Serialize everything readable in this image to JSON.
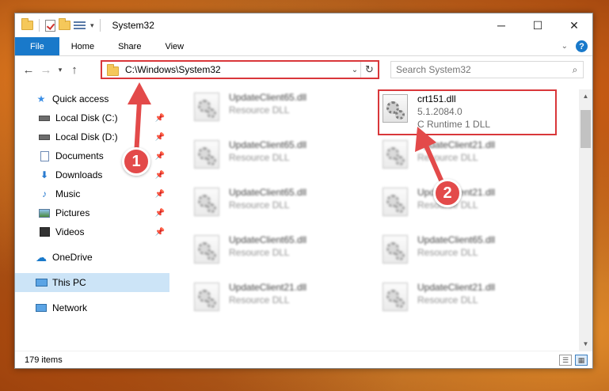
{
  "window": {
    "title": "System32",
    "controls": {
      "minimize": "─",
      "maximize": "☐",
      "close": "✕"
    }
  },
  "ribbon": {
    "tabs": [
      "File",
      "Home",
      "Share",
      "View"
    ]
  },
  "navigation": {
    "address": "C:\\Windows\\System32",
    "search_placeholder": "Search System32"
  },
  "sidebar": {
    "quick_access": "Quick access",
    "items": [
      {
        "label": "Local Disk (C:)",
        "icon": "drive-icon"
      },
      {
        "label": "Local Disk (D:)",
        "icon": "drive-icon"
      },
      {
        "label": "Documents",
        "icon": "documents-icon"
      },
      {
        "label": "Downloads",
        "icon": "downloads-icon"
      },
      {
        "label": "Music",
        "icon": "music-icon"
      },
      {
        "label": "Pictures",
        "icon": "pictures-icon"
      },
      {
        "label": "Videos",
        "icon": "videos-icon"
      }
    ],
    "onedrive": "OneDrive",
    "this_pc": "This PC",
    "network": "Network"
  },
  "files": {
    "highlighted": {
      "name": "crt151.dll",
      "version": "5.1.2084.0",
      "description": "C Runtime 1 DLL"
    },
    "left_column": [
      {
        "name": "UpdateClient65.dll",
        "type": "Resource DLL"
      },
      {
        "name": "UpdateClient65.dll",
        "type": "Resource DLL"
      },
      {
        "name": "UpdateClient65.dll",
        "type": "Resource DLL"
      },
      {
        "name": "UpdateClient65.dll",
        "type": "Resource DLL"
      },
      {
        "name": "UpdateClient21.dll",
        "type": "Resource DLL"
      }
    ],
    "right_column": [
      {
        "name": "UpdateClient21.dll",
        "type": "Resource DLL"
      },
      {
        "name": "UpdateClient21.dll",
        "type": "Resource DLL"
      },
      {
        "name": "UpdateClient65.dll",
        "type": "Resource DLL"
      },
      {
        "name": "UpdateClient21.dll",
        "type": "Resource DLL"
      }
    ]
  },
  "status": {
    "item_count": "179 items"
  },
  "annotations": {
    "badge_1": "1",
    "badge_2": "2",
    "color": "#e34a4a"
  }
}
